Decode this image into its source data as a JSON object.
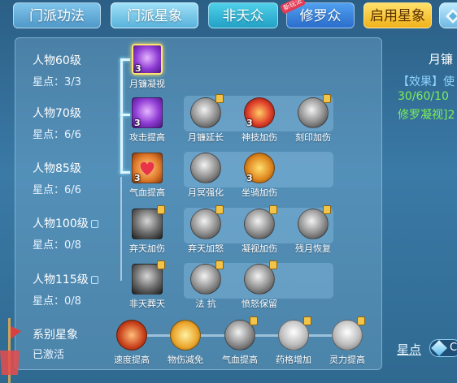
{
  "tabs": [
    {
      "label": "门派功法"
    },
    {
      "label": "门派星象"
    },
    {
      "label": "非天众"
    },
    {
      "label": "修罗众",
      "badge": "新玩法"
    },
    {
      "label": "启用星象"
    }
  ],
  "rows": [
    {
      "title": "人物60级",
      "sub": "星点：3/3",
      "locked": false
    },
    {
      "title": "人物70级",
      "sub": "星点：6/6",
      "locked": false
    },
    {
      "title": "人物85级",
      "sub": "星点：6/6",
      "locked": false
    },
    {
      "title": "人物100级",
      "sub": "星点：0/8",
      "locked": true
    },
    {
      "title": "人物115级",
      "sub": "星点：0/8",
      "locked": true
    },
    {
      "title": "系别星象",
      "sub": "已激活",
      "locked": false
    }
  ],
  "skills": {
    "r1": [
      {
        "name": "月镰凝视",
        "count": "3",
        "icon": "purple-crescent-icon"
      }
    ],
    "r2": [
      {
        "name": "攻击提高",
        "count": "3",
        "icon": "purple-crescent-icon"
      },
      {
        "name": "月镰延长",
        "count": "",
        "icon": "gray-crescent-icon"
      },
      {
        "name": "神技加伤",
        "count": "3",
        "icon": "fire-claw-icon"
      },
      {
        "name": "刻印加伤",
        "count": "",
        "icon": "gray-rune-icon"
      }
    ],
    "r3": [
      {
        "name": "气血提高",
        "count": "3",
        "icon": "heart-icon"
      },
      {
        "name": "月冥强化",
        "count": "",
        "icon": "gray-orb-icon"
      },
      {
        "name": "坐骑加伤",
        "count": "3",
        "icon": "golden-beast-icon"
      }
    ],
    "r4": [
      {
        "name": "弃天加伤",
        "count": "",
        "icon": "gray-burst-icon"
      },
      {
        "name": "弃天加怒",
        "count": "",
        "icon": "gray-burst-icon"
      },
      {
        "name": "凝视加伤",
        "count": "",
        "icon": "gray-swirl-icon"
      },
      {
        "name": "残月恢复",
        "count": "",
        "icon": "gray-moon-icon"
      }
    ],
    "r5": [
      {
        "name": "非天葬天",
        "count": "",
        "icon": "dark-warrior-icon"
      },
      {
        "name": "法 抗",
        "count": "",
        "icon": "gray-warrior-icon"
      },
      {
        "name": "愤怒保留",
        "count": "",
        "icon": "gray-warrior-icon"
      }
    ],
    "r6": [
      {
        "name": "速度提高",
        "icon": "speed-icon"
      },
      {
        "name": "物伤减免",
        "icon": "gold-figure-icon"
      },
      {
        "name": "气血提高",
        "icon": "gray-heart-icon"
      },
      {
        "name": "药格增加",
        "icon": "gray-flask-icon"
      },
      {
        "name": "灵力提高",
        "icon": "gray-spirit-icon"
      }
    ]
  },
  "right": {
    "title": "月镰",
    "effect_label": "【效果】使",
    "progress": "30/60/10",
    "skill_name": "修罗凝视]2",
    "star_points_label": "星点",
    "star_points_value": "C"
  },
  "colors": {
    "accent_yellow": "#ffe36a",
    "effect_blue": "#8fd3ff",
    "progress_green": "#7cf05a"
  }
}
